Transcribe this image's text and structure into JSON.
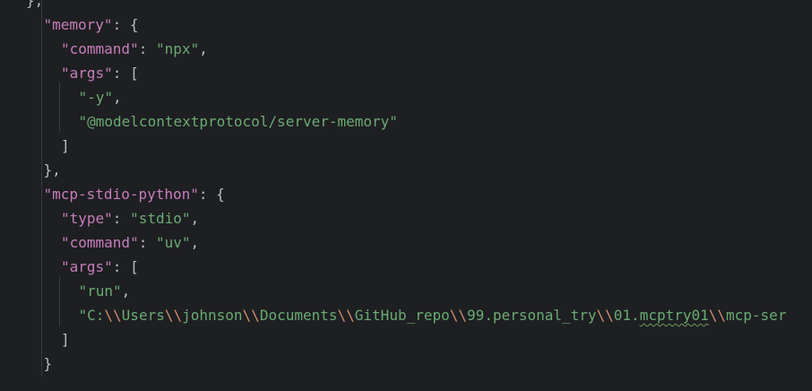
{
  "editor": {
    "lines": [
      {
        "indent": 2,
        "tokens": [
          {
            "t": "p",
            "v": "},"
          }
        ]
      },
      {
        "indent": 3,
        "tokens": [
          {
            "t": "k",
            "v": "\"memory\""
          },
          {
            "t": "p",
            "v": ": {"
          }
        ]
      },
      {
        "indent": 4,
        "tokens": [
          {
            "t": "k",
            "v": "\"command\""
          },
          {
            "t": "p",
            "v": ": "
          },
          {
            "t": "s",
            "v": "\"npx\""
          },
          {
            "t": "p",
            "v": ","
          }
        ]
      },
      {
        "indent": 4,
        "tokens": [
          {
            "t": "k",
            "v": "\"args\""
          },
          {
            "t": "p",
            "v": ": ["
          }
        ]
      },
      {
        "indent": 5,
        "tokens": [
          {
            "t": "s",
            "v": "\"-y\""
          },
          {
            "t": "p",
            "v": ","
          }
        ]
      },
      {
        "indent": 5,
        "tokens": [
          {
            "t": "s",
            "v": "\"@modelcontextprotocol/server-memory\""
          }
        ]
      },
      {
        "indent": 4,
        "tokens": [
          {
            "t": "p",
            "v": "]"
          }
        ]
      },
      {
        "indent": 3,
        "tokens": [
          {
            "t": "p",
            "v": "},"
          }
        ]
      },
      {
        "indent": 3,
        "tokens": [
          {
            "t": "k",
            "v": "\"mcp-stdio-python\""
          },
          {
            "t": "p",
            "v": ": {"
          }
        ]
      },
      {
        "indent": 4,
        "tokens": [
          {
            "t": "k",
            "v": "\"type\""
          },
          {
            "t": "p",
            "v": ": "
          },
          {
            "t": "s",
            "v": "\"stdio\""
          },
          {
            "t": "p",
            "v": ","
          }
        ]
      },
      {
        "indent": 4,
        "tokens": [
          {
            "t": "k",
            "v": "\"command\""
          },
          {
            "t": "p",
            "v": ": "
          },
          {
            "t": "s",
            "v": "\"uv\""
          },
          {
            "t": "p",
            "v": ","
          }
        ]
      },
      {
        "indent": 4,
        "tokens": [
          {
            "t": "k",
            "v": "\"args\""
          },
          {
            "t": "p",
            "v": ": ["
          }
        ]
      },
      {
        "indent": 5,
        "tokens": [
          {
            "t": "s",
            "v": "\"run\""
          },
          {
            "t": "p",
            "v": ","
          }
        ]
      },
      {
        "indent": 5,
        "tokens": [
          {
            "t": "s",
            "v": "\"C:"
          },
          {
            "t": "e",
            "v": "\\\\"
          },
          {
            "t": "s",
            "v": "Users"
          },
          {
            "t": "e",
            "v": "\\\\"
          },
          {
            "t": "s",
            "v": "johnson"
          },
          {
            "t": "e",
            "v": "\\\\"
          },
          {
            "t": "s",
            "v": "Documents"
          },
          {
            "t": "e",
            "v": "\\\\"
          },
          {
            "t": "s",
            "v": "GitHub_repo"
          },
          {
            "t": "e",
            "v": "\\\\"
          },
          {
            "t": "s",
            "v": "99.personal_try"
          },
          {
            "t": "e",
            "v": "\\\\"
          },
          {
            "t": "s",
            "v": "01."
          },
          {
            "t": "s",
            "v": "mcptry01",
            "typo": true
          },
          {
            "t": "e",
            "v": "\\\\"
          },
          {
            "t": "s",
            "v": "mcp-ser"
          }
        ]
      },
      {
        "indent": 4,
        "tokens": [
          {
            "t": "p",
            "v": "]"
          }
        ]
      },
      {
        "indent": 3,
        "tokens": [
          {
            "t": "p",
            "v": "}"
          }
        ]
      }
    ]
  },
  "colors": {
    "background": "#1e1f22",
    "key": "#c77dbb",
    "string": "#6aab73",
    "punctuation": "#bcbec4",
    "escape": "#cf8e6d",
    "indent_guide": "#393b40"
  }
}
